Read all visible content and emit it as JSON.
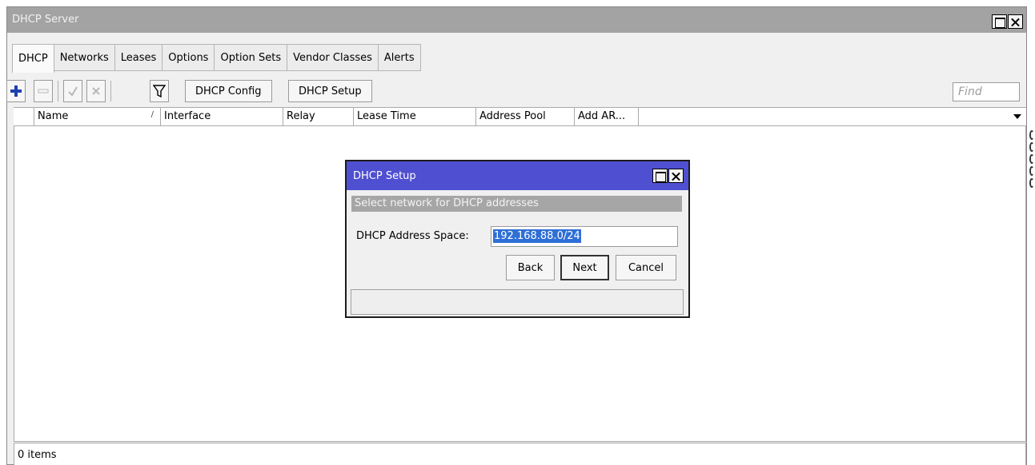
{
  "window": {
    "title": "DHCP Server"
  },
  "tabs": [
    {
      "label": "DHCP",
      "active": true
    },
    {
      "label": "Networks"
    },
    {
      "label": "Leases"
    },
    {
      "label": "Options"
    },
    {
      "label": "Option Sets"
    },
    {
      "label": "Vendor Classes"
    },
    {
      "label": "Alerts"
    }
  ],
  "toolbar": {
    "add_icon": "plus-icon",
    "remove_icon": "minus-icon",
    "enable_icon": "check-icon",
    "disable_icon": "cross-icon",
    "filter_icon": "filter-icon",
    "dhcp_config_label": "DHCP Config",
    "dhcp_setup_label": "DHCP Setup",
    "find_placeholder": "Find"
  },
  "table": {
    "columns": [
      "Name",
      "Interface",
      "Relay",
      "Lease Time",
      "Address Pool",
      "Add AR..."
    ],
    "rows": []
  },
  "status": {
    "items_text": "0 items"
  },
  "dialog": {
    "title": "DHCP Setup",
    "subtitle": "Select network for DHCP addresses",
    "field_label": "DHCP Address Space:",
    "field_value": "192.168.88.0/24",
    "back_label": "Back",
    "next_label": "Next",
    "cancel_label": "Cancel"
  },
  "colors": {
    "dialog_title_bg": "#4f4fd2",
    "selection": "#2f6fd6",
    "add_icon": "#1f3fb0"
  }
}
